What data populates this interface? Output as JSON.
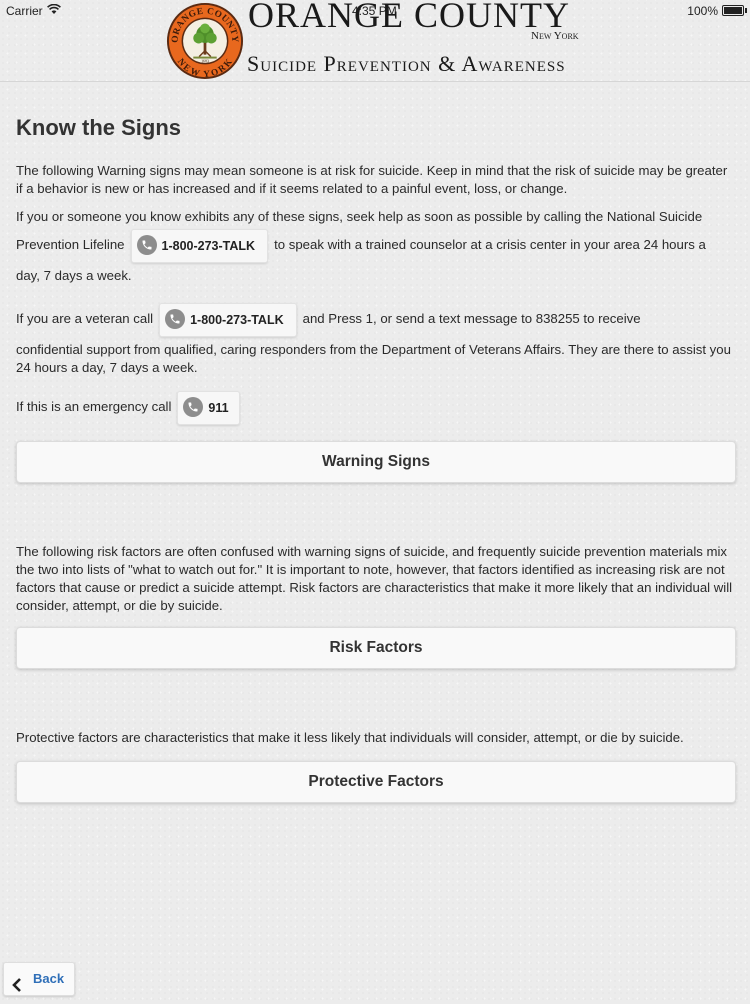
{
  "status_bar": {
    "carrier": "Carrier",
    "time": "4:35 PM",
    "battery": "100%"
  },
  "header": {
    "seal_top_text": "ORANGE COUNTY",
    "seal_bottom_text": "NEW YORK",
    "seal_center_text": "1683",
    "title": "ORANGE COUNTY",
    "state": "New York",
    "subtitle": "Suicide Prevention & Awareness"
  },
  "main": {
    "heading": "Know the Signs",
    "intro": "The following Warning signs may mean someone is at risk for suicide. Keep in mind that the risk of suicide may be greater if a behavior is new or has increased and if it seems related to a painful event, loss, or change.",
    "lifeline_line1": "If you or someone you know exhibits any of these signs, seek help as soon as possible by calling the National Suicide",
    "lifeline_prefix": "Prevention Lifeline",
    "lifeline_number": "1-800-273-TALK",
    "lifeline_suffix": "to speak with a trained counselor at a crisis center in your area 24 hours a",
    "lifeline_line3": "day, 7 days a week.",
    "veteran_prefix": "If you are a veteran call",
    "veteran_number": "1-800-273-TALK",
    "veteran_suffix": "and Press 1, or send a text message to 838255 to receive",
    "veteran_rest": "confidential support from qualified, caring responders from the Department of Veterans Affairs. They are there to assist you 24 hours a day, 7 days a week.",
    "emergency_prefix": "If this is an emergency call",
    "emergency_number": "911",
    "warning_signs_label": "Warning Signs",
    "risk_text": "The following risk factors are often confused with warning signs of suicide, and frequently suicide prevention materials mix the two into lists of \"what to watch out for.\" It is important to note, however, that factors identified as increasing risk are not factors that cause or predict a suicide attempt. Risk factors are characteristics that make it more likely that an individual will consider, attempt, or die by suicide.",
    "risk_factors_label": "Risk Factors",
    "protective_text": "Protective factors are characteristics that make it less likely that individuals will consider, attempt, or die by suicide.",
    "protective_factors_label": "Protective Factors"
  },
  "footer": {
    "back_label": "Back"
  },
  "colors": {
    "link_blue": "#2f6fb8",
    "seal_orange": "#e8681e",
    "seal_brown": "#5a2a12"
  }
}
